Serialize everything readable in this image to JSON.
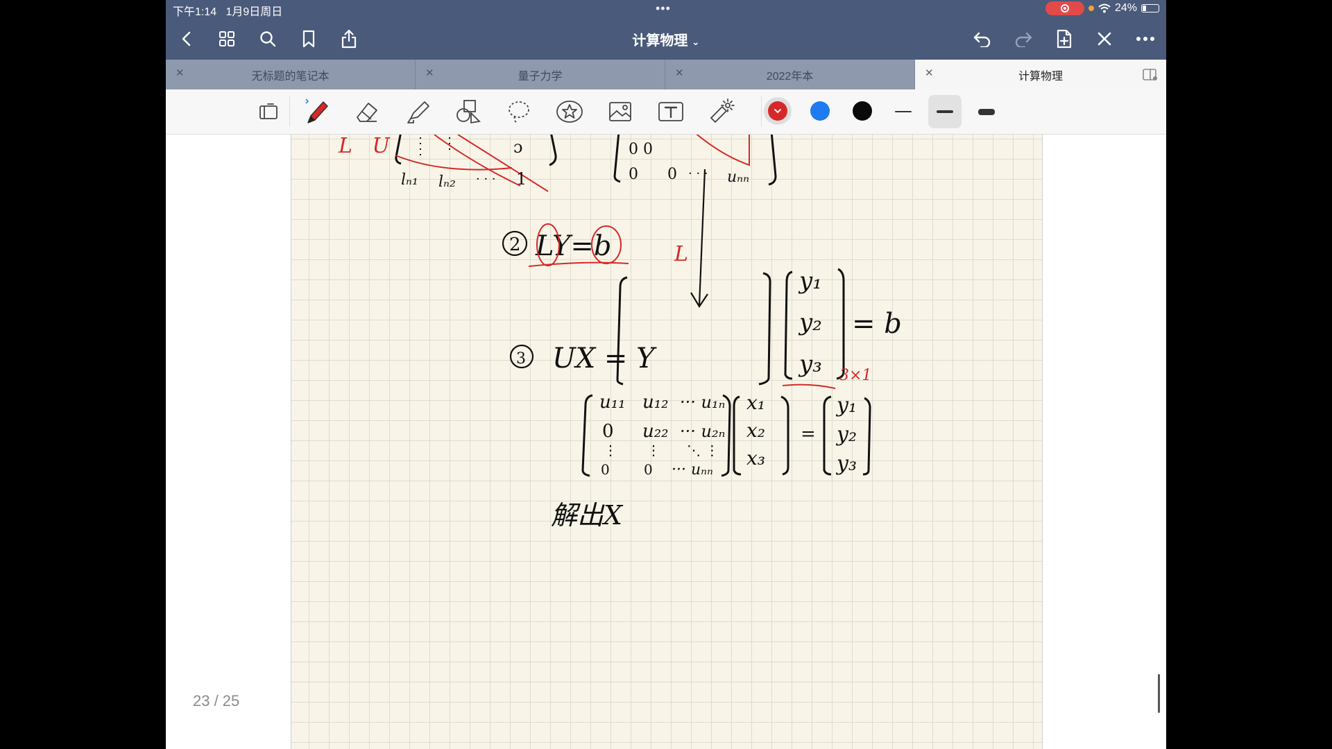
{
  "status_bar": {
    "time": "下午1:14",
    "date": "1月9日周日",
    "battery_percent": "24%",
    "battery_level": 0.24
  },
  "nav": {
    "title": "计算物理",
    "left_icons": [
      "back-chevron-icon",
      "grid-view-icon",
      "search-icon",
      "bookmark-icon",
      "share-icon"
    ],
    "right_icons": [
      "undo-icon",
      "redo-icon",
      "add-page-icon",
      "close-x-icon",
      "more-icon"
    ]
  },
  "tabs": [
    {
      "label": "无标题的笔记本",
      "active": false
    },
    {
      "label": "量子力学",
      "active": false
    },
    {
      "label": "2022年本",
      "active": false
    },
    {
      "label": "计算物理",
      "active": true
    }
  ],
  "toolbar": {
    "tools": [
      "page-view-icon",
      "pen-icon",
      "eraser-icon",
      "highlighter-icon",
      "shapes-icon",
      "lasso-icon",
      "sticker-icon",
      "image-icon",
      "text-icon",
      "laser-pointer-icon"
    ],
    "selected_tool": "pen-icon",
    "colors": [
      "#d62828",
      "#1e7bf0",
      "#0a0a0a"
    ],
    "selected_color": "#d62828",
    "stroke_widths": [
      "thin",
      "medium",
      "thick"
    ],
    "selected_stroke": "medium"
  },
  "handwriting": {
    "step2_marker": "②",
    "step2_equation": "LY=b",
    "red_L_label": "L",
    "vector_y": [
      "y₁",
      "y₂",
      "y₃"
    ],
    "equals_b": "= b",
    "size_note": "3×1",
    "step3_marker": "③",
    "step3_equation": "UX = Y",
    "upper_matrix": [
      [
        "u₁₁",
        "u₁₂",
        "··· u₁ₙ"
      ],
      [
        "0",
        "u₂₂",
        "··· u₂ₙ"
      ],
      [
        "⋮",
        "⋮",
        "⋱ ⋮"
      ],
      [
        "0",
        "0",
        "··· uₙₙ"
      ]
    ],
    "vector_x": [
      "x₁",
      "x₂",
      "x₃"
    ],
    "vector_y2": [
      "y₁",
      "y₂",
      "y₃"
    ],
    "solve_note": "解出X",
    "top_left_fragment": "L   U",
    "top_matrix_row": [
      "lₙ₁",
      "lₙ₂",
      "· · ·",
      "1"
    ],
    "top_matrix_right_row": [
      "0",
      "0",
      "· · ·",
      "uₙₙ"
    ]
  },
  "page_indicator": "23 / 25"
}
